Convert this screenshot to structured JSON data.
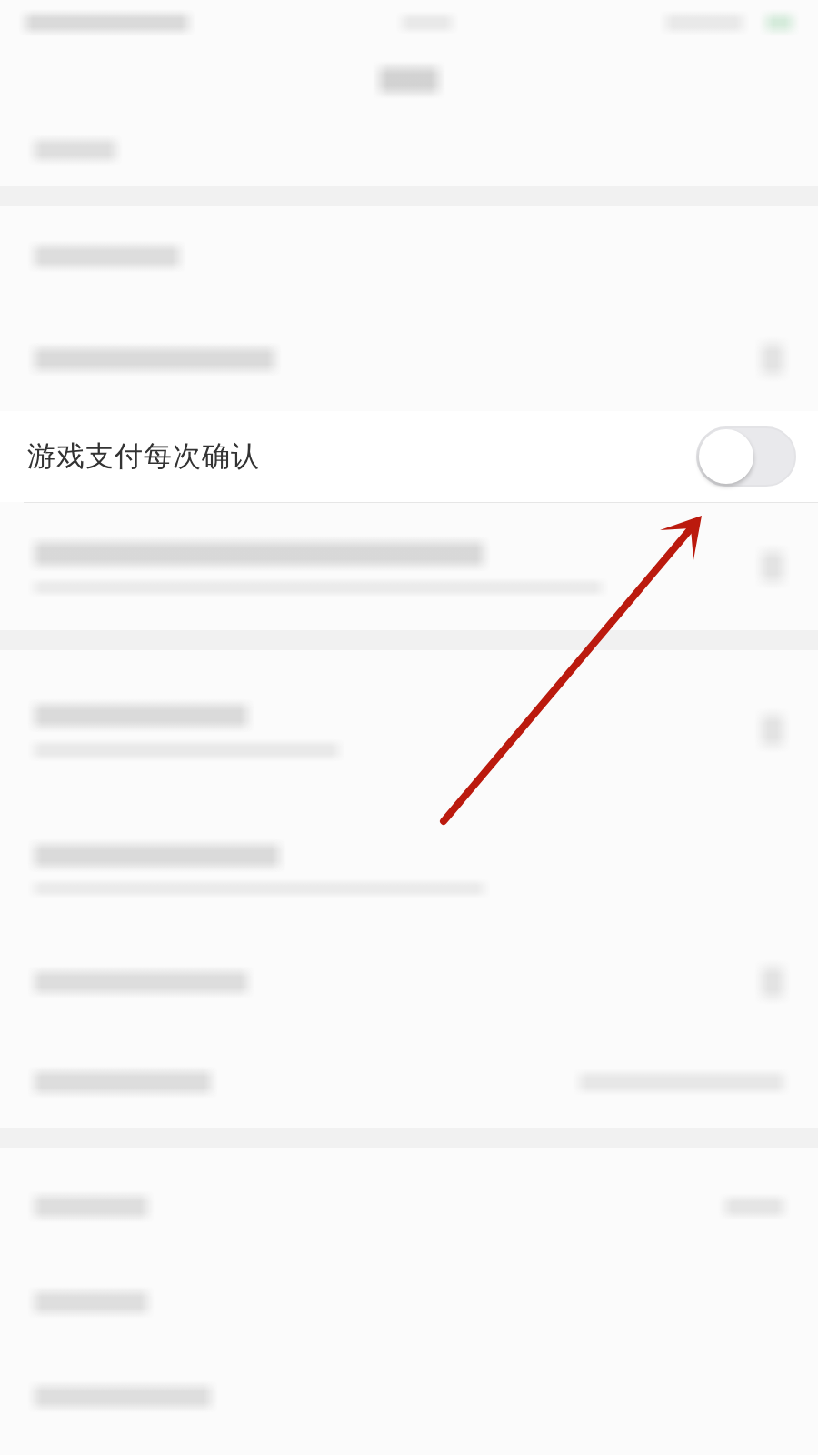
{
  "settings_row": {
    "label": "游戏支付每次确认",
    "on": false
  }
}
